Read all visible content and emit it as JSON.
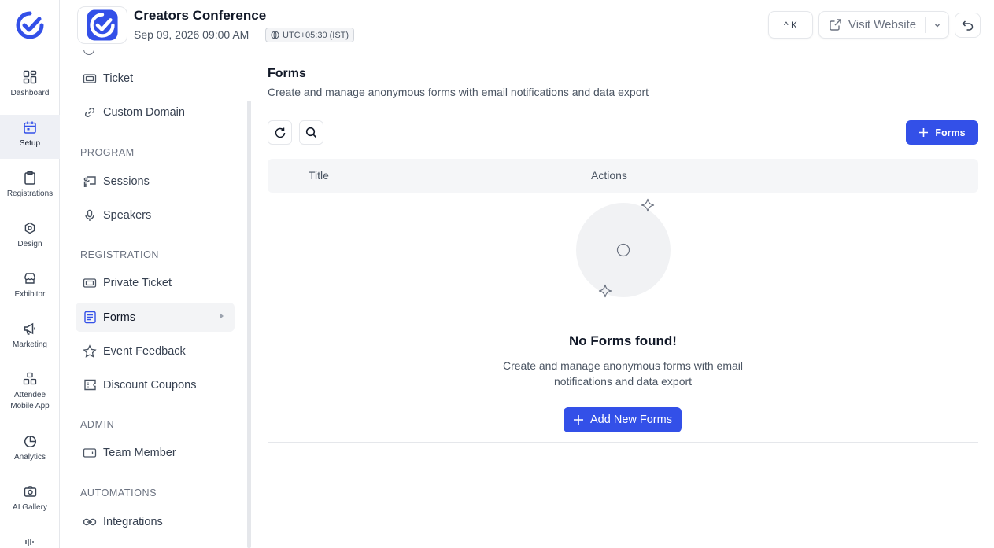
{
  "brand": {
    "accent": "#3350e8"
  },
  "rail": {
    "items": [
      {
        "label": "Dashboard",
        "icon": "grid-icon"
      },
      {
        "label": "Setup",
        "icon": "calendar-icon",
        "active": true
      },
      {
        "label": "Registrations",
        "icon": "clipboard-icon"
      },
      {
        "label": "Design",
        "icon": "hexagon-icon"
      },
      {
        "label": "Exhibitor",
        "icon": "store-icon"
      },
      {
        "label": "Marketing",
        "icon": "megaphone-icon"
      },
      {
        "label": "Attendee Mobile App",
        "icon": "boxes-icon"
      },
      {
        "label": "Analytics",
        "icon": "pie-chart-icon"
      },
      {
        "label": "AI Gallery",
        "icon": "camera-icon"
      }
    ]
  },
  "header": {
    "event_title": "Creators Conference",
    "event_date": "Sep 09, 2026 09:00 AM",
    "timezone": "UTC+05:30 (IST)",
    "shortcut": "^ K",
    "visit_website": "Visit Website"
  },
  "sidebar": {
    "top_items": [
      {
        "label": "Ticket",
        "icon": "ticket-icon"
      },
      {
        "label": "Custom Domain",
        "icon": "link-icon"
      }
    ],
    "sections": [
      {
        "title": "PROGRAM",
        "items": [
          {
            "label": "Sessions",
            "icon": "presentation-icon"
          },
          {
            "label": "Speakers",
            "icon": "mic-icon"
          }
        ]
      },
      {
        "title": "REGISTRATION",
        "items": [
          {
            "label": "Private Ticket",
            "icon": "ticket-icon"
          },
          {
            "label": "Forms",
            "icon": "form-icon",
            "active": true
          },
          {
            "label": "Event Feedback",
            "icon": "star-icon"
          },
          {
            "label": "Discount Coupons",
            "icon": "coupon-icon"
          }
        ]
      },
      {
        "title": "ADMIN",
        "items": [
          {
            "label": "Team Member",
            "icon": "id-card-icon"
          }
        ]
      },
      {
        "title": "AUTOMATIONS",
        "items": [
          {
            "label": "Integrations",
            "icon": "link-icon"
          }
        ]
      }
    ]
  },
  "main": {
    "title": "Forms",
    "subtitle": "Create and manage anonymous forms with email notifications and data export",
    "add_button": "Forms",
    "table": {
      "columns": [
        "Title",
        "Actions"
      ]
    },
    "empty": {
      "title": "No Forms found!",
      "description": "Create and manage anonymous forms with email notifications and data export",
      "button": "Add New Forms"
    }
  }
}
